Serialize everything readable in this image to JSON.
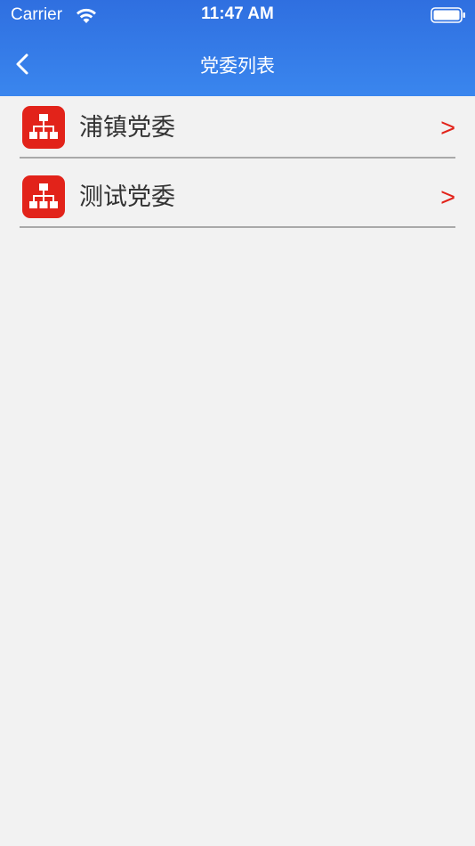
{
  "status_bar": {
    "carrier": "Carrier",
    "time": "11:47 AM",
    "wifi_icon": "wifi-icon",
    "battery_icon": "battery-icon"
  },
  "nav": {
    "title": "党委列表",
    "back_icon": "chevron-left-icon"
  },
  "list": {
    "items": [
      {
        "label": "浦镇党委",
        "chevron": ">",
        "icon": "org-chart-icon"
      },
      {
        "label": "测试党委",
        "chevron": ">",
        "icon": "org-chart-icon"
      }
    ]
  },
  "colors": {
    "header_top": "#2f6fe0",
    "header_bottom": "#3a86ee",
    "accent_red": "#e2231a",
    "background": "#f2f2f2",
    "divider": "#a9a9a9"
  }
}
